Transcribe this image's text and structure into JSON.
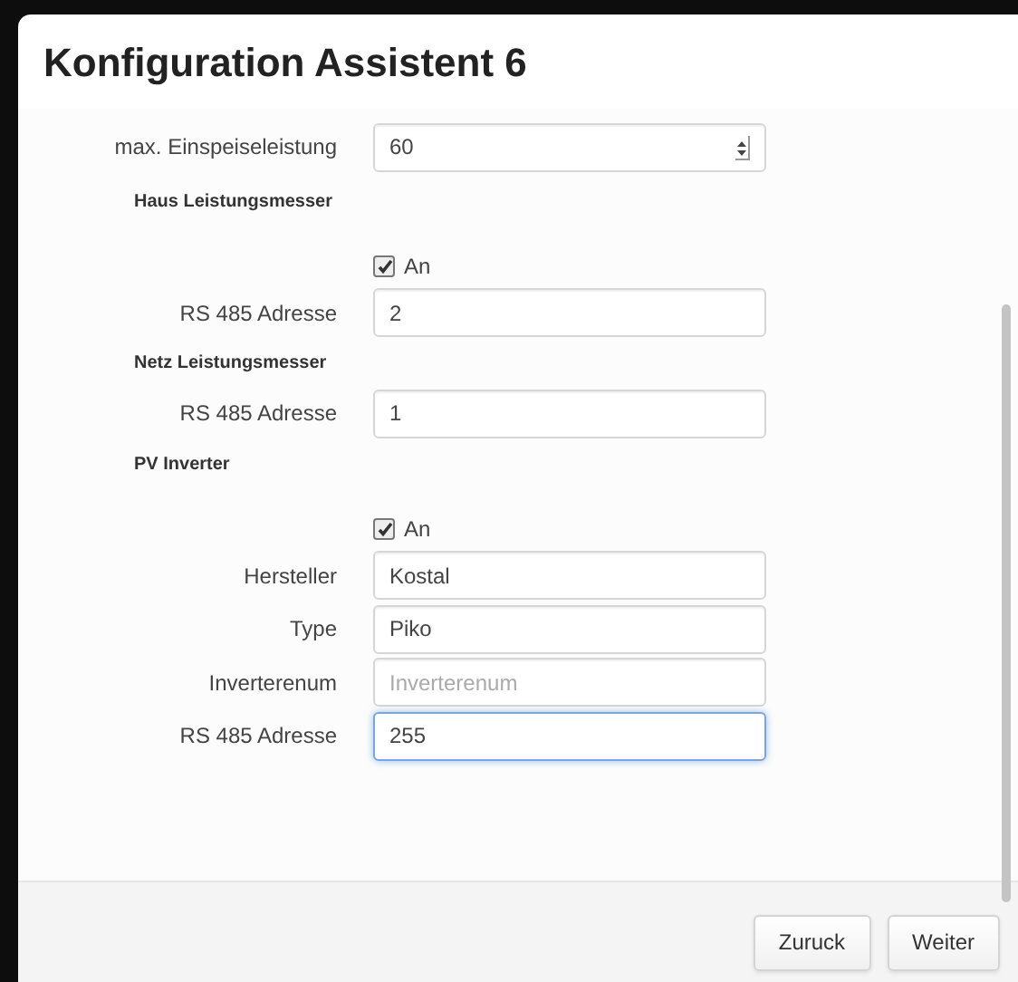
{
  "window": {
    "title": "Konfiguration Assistent 6"
  },
  "rows": [
    {
      "kind": "select",
      "label": "max. Einspeiseleistung",
      "value": "60"
    },
    {
      "kind": "heading",
      "label": "Haus Leistungsmesser"
    },
    {
      "kind": "checkbox",
      "label": "An",
      "checked": true
    },
    {
      "kind": "input",
      "label": "RS 485 Adresse",
      "value": "2"
    },
    {
      "kind": "heading",
      "label": "Netz Leistungsmesser"
    },
    {
      "kind": "input",
      "label": "RS 485 Adresse",
      "value": "1"
    },
    {
      "kind": "heading",
      "label": "PV Inverter"
    },
    {
      "kind": "checkbox",
      "label": "An",
      "checked": true
    },
    {
      "kind": "input",
      "label": "Hersteller",
      "value": "Kostal"
    },
    {
      "kind": "input",
      "label": "Type",
      "value": "Piko"
    },
    {
      "kind": "input",
      "label": "Inverterenum",
      "placeholder": "Inverterenum"
    },
    {
      "kind": "input",
      "label": "RS 485 Adresse",
      "value": "255",
      "focused": true
    }
  ],
  "buttons": [
    {
      "label": "Zuruck"
    },
    {
      "label": "Weiter"
    }
  ]
}
